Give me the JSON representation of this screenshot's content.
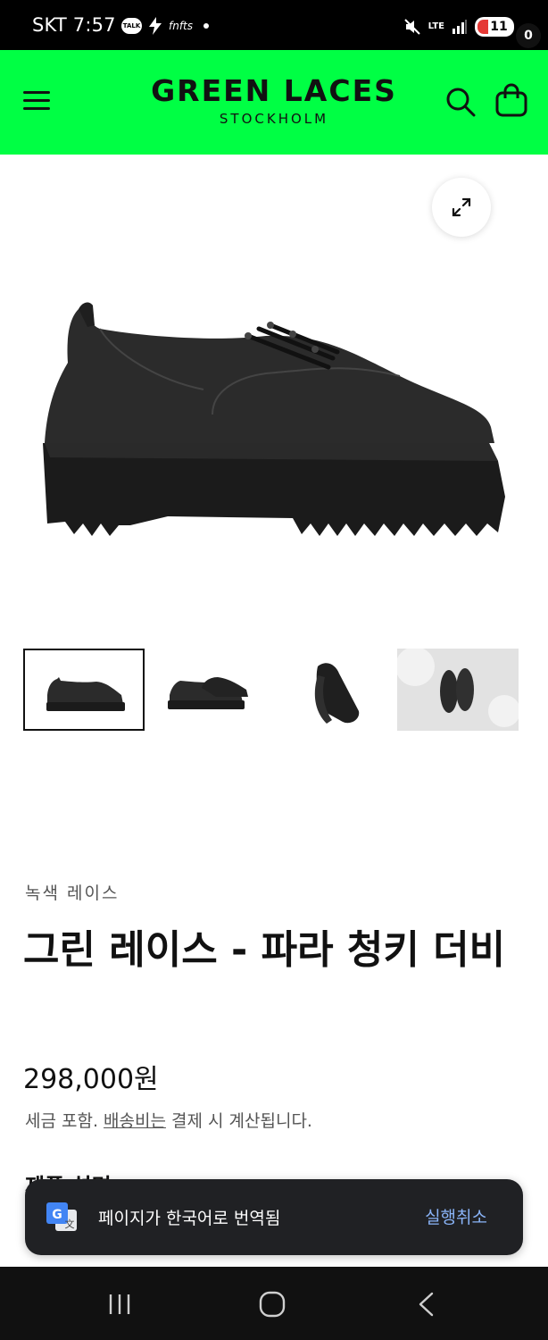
{
  "status_bar": {
    "carrier_time": "SKT 7:57",
    "talk_label": "TALK",
    "app_label": "fnfts",
    "network": "LTE",
    "battery": "11"
  },
  "header": {
    "brand_name": "GREEN LACES",
    "brand_sub": "STOCKHOLM",
    "cart_count": "0",
    "background": "#00ff44"
  },
  "product": {
    "vendor": "녹색 레이스",
    "title": "그린 레이스 - 파라 청키 더비",
    "price": "298,000원",
    "tax_note_prefix": "세금 포함. ",
    "tax_note_link": "배송비는",
    "tax_note_suffix": " 결제 시 계산됩니다.",
    "section_heading": "제품 설명"
  },
  "thumbnails": [
    "shoe-side-view",
    "shoe-pair-view",
    "shoe-sole-view",
    "shoe-lifestyle-view"
  ],
  "toast": {
    "message": "페이지가 한국어로 번역됨",
    "action": "실행취소",
    "icon_letter": "G",
    "icon_secondary": "文"
  },
  "icons": {
    "menu": "hamburger-menu-icon",
    "search": "search-icon",
    "cart": "cart-icon",
    "zoom": "expand-icon",
    "translate": "google-translate-icon",
    "nav_recent": "recent-apps-icon",
    "nav_home": "home-icon",
    "nav_back": "back-icon"
  }
}
